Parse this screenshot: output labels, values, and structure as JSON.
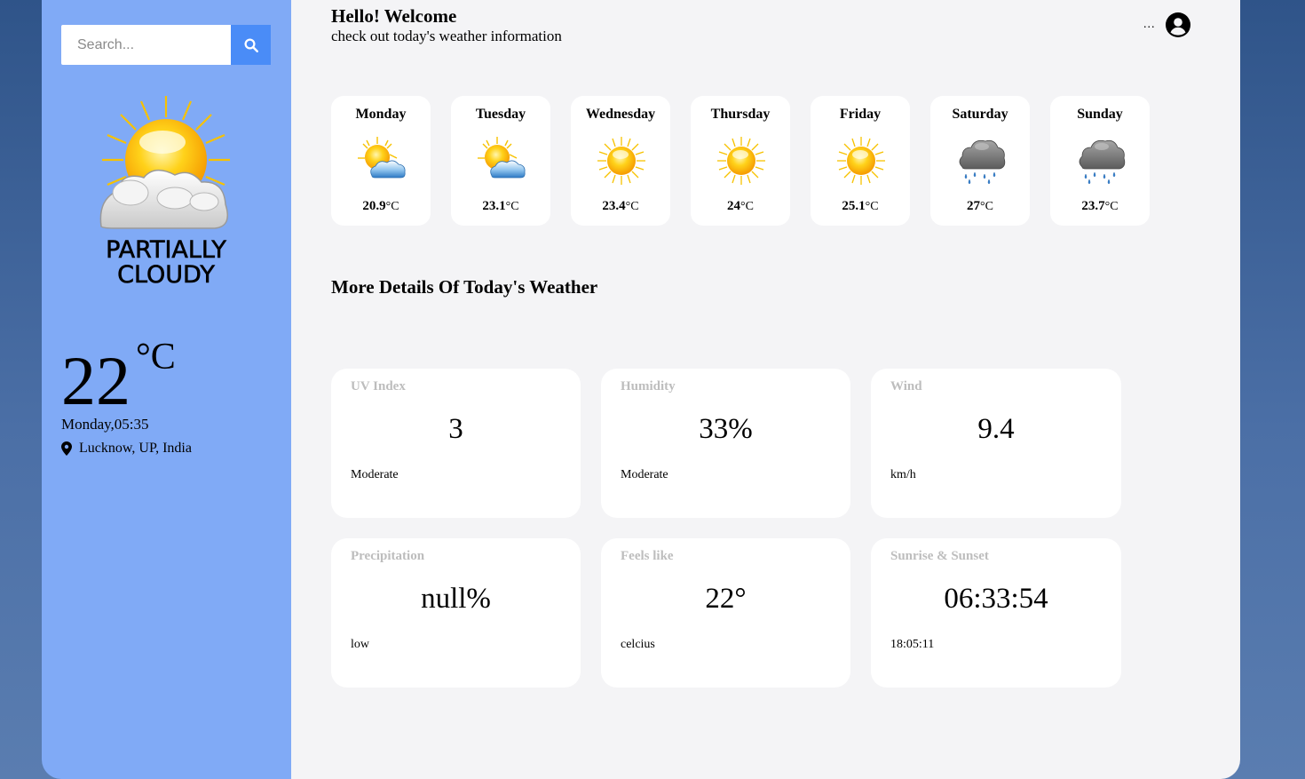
{
  "search": {
    "placeholder": "Search..."
  },
  "current": {
    "condition_line1": "PARTIALLY",
    "condition_line2": "CLOUDY",
    "temp": "22",
    "unit": "°C",
    "datetime": "Monday,05:35",
    "location": "Lucknow, UP, India"
  },
  "header": {
    "greeting": "Hello! Welcome",
    "subtitle": "check out today's weather information",
    "menu": "..."
  },
  "week": [
    {
      "day": "Monday",
      "temp": "20.9",
      "unit": "°C",
      "icon": "partly-cloudy-icon"
    },
    {
      "day": "Tuesday",
      "temp": "23.1",
      "unit": "°C",
      "icon": "partly-cloudy-icon"
    },
    {
      "day": "Wednesday",
      "temp": "23.4",
      "unit": "°C",
      "icon": "sun-icon"
    },
    {
      "day": "Thursday",
      "temp": "24",
      "unit": "°C",
      "icon": "sun-icon"
    },
    {
      "day": "Friday",
      "temp": "25.1",
      "unit": "°C",
      "icon": "sun-icon"
    },
    {
      "day": "Saturday",
      "temp": "27",
      "unit": "°C",
      "icon": "rain-cloud-icon"
    },
    {
      "day": "Sunday",
      "temp": "23.7",
      "unit": "°C",
      "icon": "rain-cloud-icon"
    }
  ],
  "details_title": "More Details Of Today's Weather",
  "details": [
    {
      "label": "UV Index",
      "value": "3",
      "sub": "Moderate"
    },
    {
      "label": "Humidity",
      "value": "33%",
      "sub": "Moderate"
    },
    {
      "label": "Wind",
      "value": "9.4",
      "sub": "km/h"
    },
    {
      "label": "Precipitation",
      "value": "null%",
      "sub": "low"
    },
    {
      "label": "Feels like",
      "value": "22°",
      "sub": "celcius"
    },
    {
      "label": "Sunrise & Sunset",
      "value": "06:33:54",
      "sub": "18:05:11"
    }
  ],
  "colors": {
    "sidebar": "#80aaf6",
    "main": "#f4f4f6",
    "search_button": "#4a8cf7",
    "card_label": "#bdbdbd"
  }
}
